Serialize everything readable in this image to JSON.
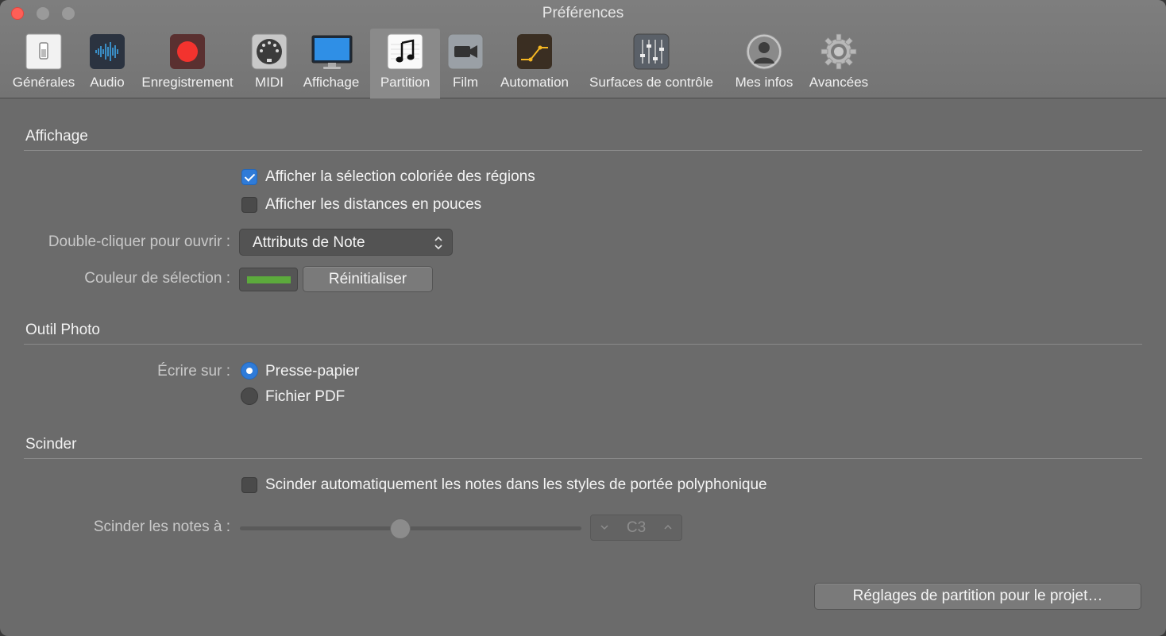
{
  "window": {
    "title": "Préférences"
  },
  "tabs": [
    {
      "label": "Générales",
      "icon": "general-switch-icon"
    },
    {
      "label": "Audio",
      "icon": "audio-waveform-icon"
    },
    {
      "label": "Enregistrement",
      "icon": "record-icon"
    },
    {
      "label": "MIDI",
      "icon": "midi-connector-icon"
    },
    {
      "label": "Affichage",
      "icon": "display-monitor-icon"
    },
    {
      "label": "Partition",
      "icon": "music-note-icon",
      "selected": true
    },
    {
      "label": "Film",
      "icon": "video-camera-icon"
    },
    {
      "label": "Automation",
      "icon": "automation-curve-icon"
    },
    {
      "label": "Surfaces de contrôle",
      "icon": "faders-icon"
    },
    {
      "label": "Mes infos",
      "icon": "user-silhouette-icon"
    },
    {
      "label": "Avancées",
      "icon": "gear-icon"
    }
  ],
  "display": {
    "title": "Affichage",
    "show_colored_selection": {
      "label": "Afficher la sélection coloriée des régions",
      "checked": true
    },
    "show_inch_distances": {
      "label": "Afficher les distances en pouces",
      "checked": false
    },
    "double_click_label": "Double-cliquer pour ouvrir :",
    "double_click_value": "Attributs de Note",
    "selection_color_label": "Couleur de sélection :",
    "selection_color": "#5caa3c",
    "reset_button": "Réinitialiser"
  },
  "photo_tool": {
    "title": "Outil Photo",
    "write_to_label": "Écrire sur :",
    "options": [
      {
        "label": "Presse-papier",
        "selected": true
      },
      {
        "label": "Fichier PDF",
        "selected": false
      }
    ]
  },
  "split": {
    "title": "Scinder",
    "auto_split": {
      "label": "Scinder automatiquement les notes dans les styles de portée polyphonique",
      "checked": false
    },
    "split_at_label": "Scinder les notes à :",
    "split_at_value": "C3",
    "slider_fraction": 0.47
  },
  "project_settings_button": "Réglages de partition pour le projet…",
  "colors": {
    "accent": "#2f7bd8",
    "close": "#fe5f57"
  }
}
